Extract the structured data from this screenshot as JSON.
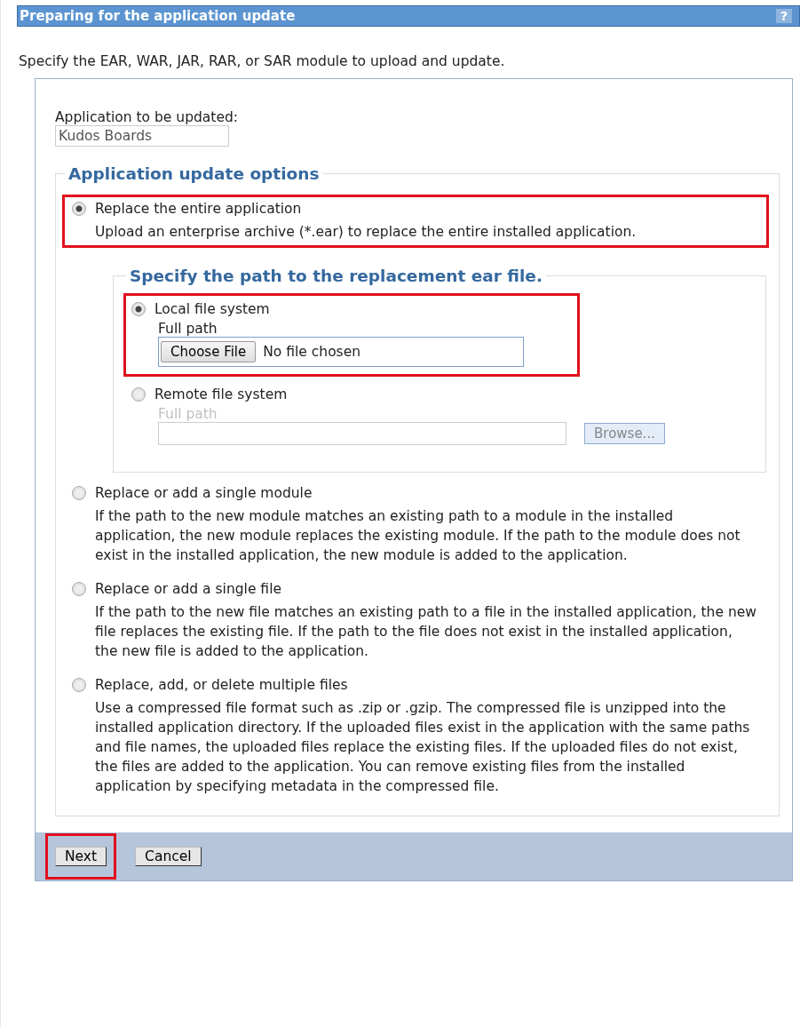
{
  "window": {
    "title": "Preparing for the application update",
    "help": "?"
  },
  "intro": "Specify the EAR, WAR, JAR, RAR, or SAR module to upload and update.",
  "application": {
    "label": "Application to be updated:",
    "value": "Kudos Boards"
  },
  "options_group": {
    "legend": "Application update options",
    "options": [
      {
        "label": "Replace the entire application",
        "description": "Upload an enterprise archive (*.ear) to replace the entire installed application.",
        "selected": true,
        "highlighted": true,
        "path_group": {
          "legend": "Specify the path to the replacement ear file.",
          "sources": [
            {
              "kind": "file",
              "label": "Local file system",
              "selected": true,
              "highlighted": true,
              "field_label": "Full path",
              "disabled": false,
              "button": "Choose File",
              "status": "No file chosen"
            },
            {
              "kind": "browse",
              "label": "Remote file system",
              "selected": false,
              "highlighted": false,
              "field_label": "Full path",
              "disabled": true,
              "button": "Browse..."
            }
          ]
        }
      },
      {
        "label": "Replace or add a single module",
        "description": "If the path to the new module matches an existing path to a module in the installed application, the new module replaces the existing module. If the path to the module does not exist in the installed application, the new module is added to the application.",
        "selected": false,
        "highlighted": false
      },
      {
        "label": "Replace or add a single file",
        "description": "If the path to the new file matches an existing path to a file in the installed application, the new file replaces the existing file. If the path to the file does not exist in the installed application, the new file is added to the application.",
        "selected": false,
        "highlighted": false
      },
      {
        "label": "Replace, add, or delete multiple files",
        "description": "Use a compressed file format such as .zip or .gzip. The compressed file is unzipped into the installed application directory. If the uploaded files exist in the application with the same paths and file names, the uploaded files replace the existing files. If the uploaded files do not exist, the files are added to the application. You can remove existing files from the installed application by specifying metadata in the compressed file.",
        "selected": false,
        "highlighted": false
      }
    ]
  },
  "buttons": [
    {
      "label": "Next",
      "highlighted": true
    },
    {
      "label": "Cancel",
      "highlighted": false
    }
  ]
}
